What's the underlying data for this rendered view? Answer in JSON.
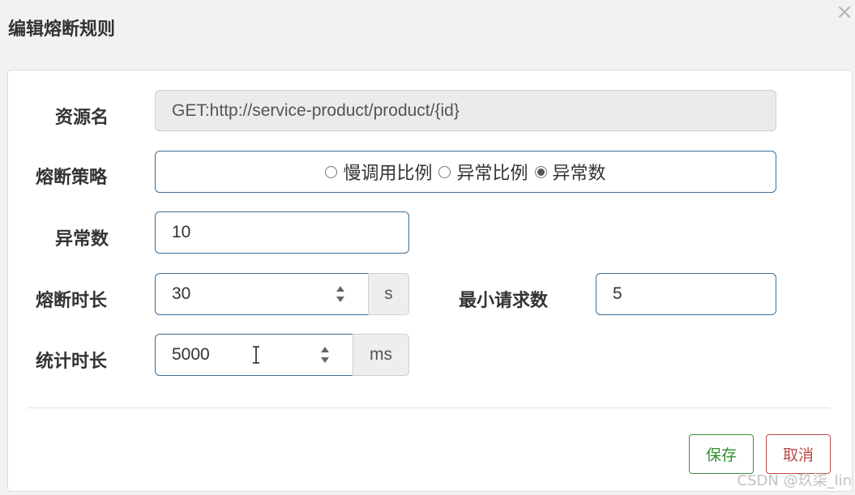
{
  "dialog": {
    "title": "编辑熔断规则",
    "close_icon": "close-icon",
    "close_glyph": "×"
  },
  "form": {
    "resource": {
      "label": "资源名",
      "value": "GET:http://service-product/product/{id}"
    },
    "strategy": {
      "label": "熔断策略",
      "options": [
        {
          "label": "慢调用比例",
          "selected": false
        },
        {
          "label": "异常比例",
          "selected": false
        },
        {
          "label": "异常数",
          "selected": true
        }
      ]
    },
    "exception_count": {
      "label": "异常数",
      "value": "10"
    },
    "break_duration": {
      "label": "熔断时长",
      "value": "30",
      "unit": "s"
    },
    "min_request": {
      "label": "最小请求数",
      "value": "5"
    },
    "stat_duration": {
      "label": "统计时长",
      "value": "5000",
      "unit": "ms"
    }
  },
  "buttons": {
    "save_label": "保存",
    "cancel_label": "取消"
  },
  "watermark": "CSDN @玖柒_lin",
  "colors": {
    "input_border": "#3d6e96",
    "save": "#2f8f2f",
    "cancel": "#b94a48"
  }
}
